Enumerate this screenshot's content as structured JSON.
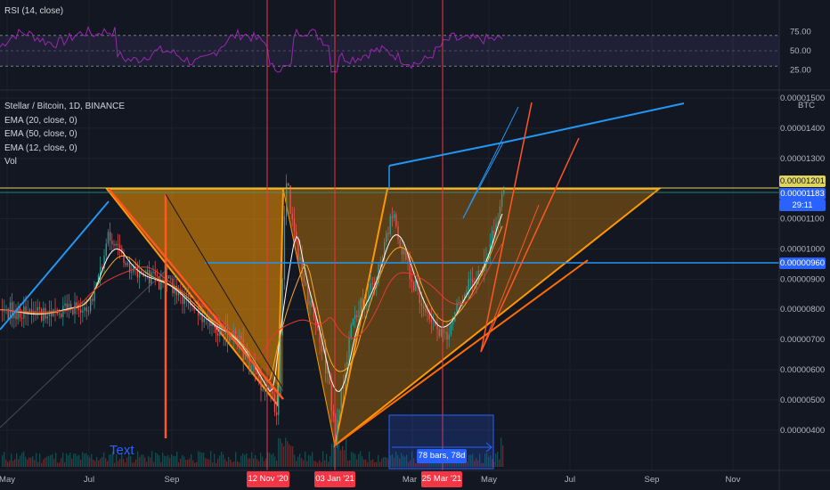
{
  "panes": {
    "rsi_label": "RSI (14, close)",
    "rsi_levels": [
      "75.00",
      "50.00",
      "25.00"
    ],
    "rsi_right_top": "BTC"
  },
  "legend": {
    "title": "Stellar / Bitcoin, 1D, BINANCE",
    "indicators": [
      "EMA (20, close, 0)",
      "EMA (50, close, 0)",
      "EMA (12, close, 0)",
      "Vol"
    ]
  },
  "price_axis": {
    "labels": [
      "0.00001500",
      "0.00001400",
      "0.00001300",
      "0.00001100",
      "0.00001000",
      "0.00000900",
      "0.00000800",
      "0.00000700",
      "0.00000600",
      "0.00000500",
      "0.00000400"
    ],
    "tags": {
      "yellow": "0.00001201",
      "current": "0.00001183",
      "countdown": "29:11",
      "line": "0.00000960"
    }
  },
  "time_axis": {
    "labels": [
      "May",
      "Jul",
      "Sep",
      "Mar",
      "May",
      "Jul",
      "Sep",
      "Nov"
    ],
    "date_tags": [
      "12 Nov '20",
      "03 Jan '21",
      "25 Mar '21"
    ]
  },
  "annotations": {
    "text_note": "Text",
    "range": "78 bars, 78d"
  },
  "colors": {
    "background": "#131722",
    "bull": "#26a69a",
    "bear": "#ef5350",
    "rsi": "#9c27b0",
    "orange": "#ff9800",
    "blue_line": "#2196f3",
    "red_line": "#f23645",
    "yellow_line": "#e0d55c",
    "tag_blue": "#2962ff"
  },
  "chart_data": {
    "type": "candlestick",
    "symbol": "Stellar / Bitcoin",
    "interval": "1D",
    "exchange": "BINANCE",
    "ylim": [
      3.7e-06,
      1.52e-05
    ],
    "horizontal_levels": [
      1.201e-05,
      9.6e-06
    ],
    "current_price": 1.183e-05,
    "close_path": [
      {
        "x": "May",
        "y": 7.8e-06
      },
      {
        "x": "Jun",
        "y": 8e-06
      },
      {
        "x": "Jul",
        "y": 8.2e-06
      },
      {
        "x": "Jul (mid)",
        "y": 1.04e-05
      },
      {
        "x": "Aug",
        "y": 9e-06
      },
      {
        "x": "Sep",
        "y": 8.2e-06
      },
      {
        "x": "Oct",
        "y": 6.8e-06
      },
      {
        "x": "Nov",
        "y": 5e-06
      },
      {
        "x": "12 Nov '20",
        "y": 1.22e-05
      },
      {
        "x": "Dec",
        "y": 8.5e-06
      },
      {
        "x": "03 Jan '21",
        "y": 4e-06
      },
      {
        "x": "Feb",
        "y": 1e-05
      },
      {
        "x": "Mar",
        "y": 7.5e-06
      },
      {
        "x": "25 Mar '21",
        "y": 7e-06
      },
      {
        "x": "Apr",
        "y": 8.8e-06
      },
      {
        "x": "May",
        "y": 1.183e-05
      }
    ],
    "rsi_levels": [
      75,
      50,
      25
    ]
  }
}
